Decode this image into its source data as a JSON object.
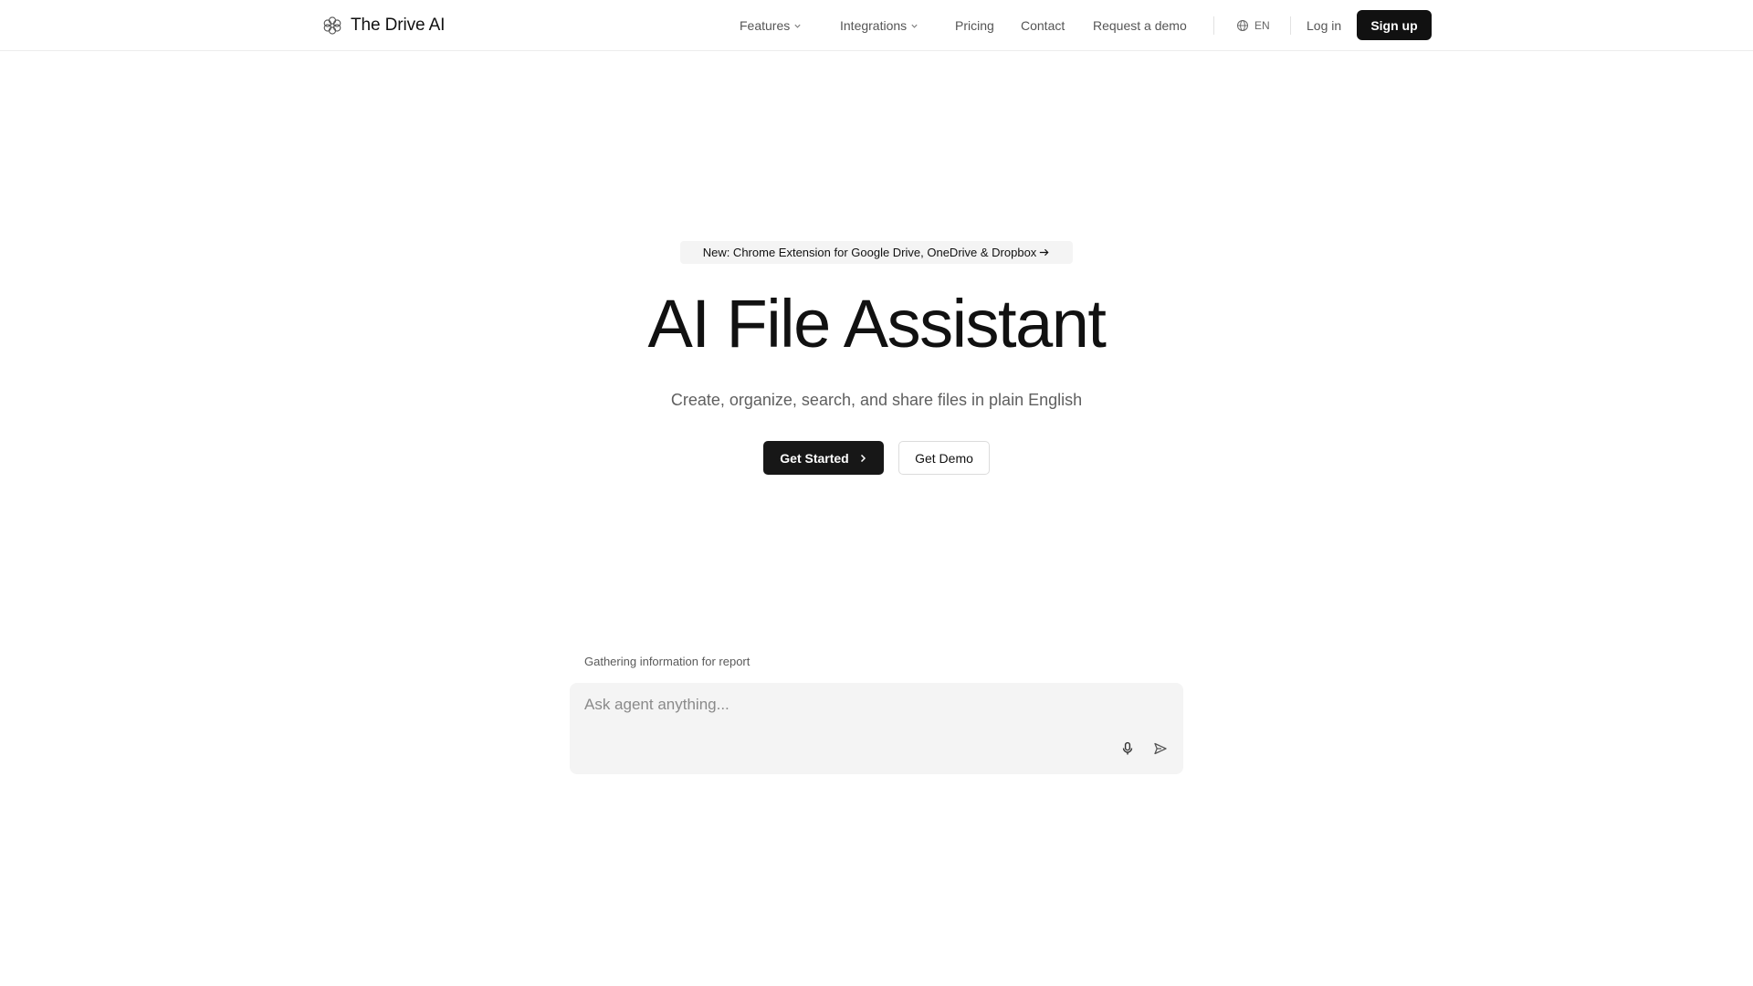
{
  "brand": {
    "name": "The Drive AI",
    "logo_icon": "flower-logo-icon"
  },
  "nav": {
    "features": "Features",
    "integrations": "Integrations",
    "pricing": "Pricing",
    "contact": "Contact",
    "request_demo": "Request a demo",
    "language": "EN",
    "login": "Log in",
    "signup": "Sign up"
  },
  "hero": {
    "announcement": "New: Chrome Extension for Google Drive, OneDrive & Dropbox",
    "title": "AI File Assistant",
    "subtitle": "Create, organize, search, and share files in plain English",
    "primary_cta": "Get Started",
    "secondary_cta": "Get Demo"
  },
  "agent": {
    "status": "Gathering information for report",
    "placeholder": "Ask agent anything...",
    "input_value": "",
    "mic_icon": "microphone-icon",
    "send_icon": "send-icon"
  },
  "colors": {
    "primary": "#171717",
    "text_muted": "#5f5f5f",
    "surface": "#f4f4f4"
  }
}
